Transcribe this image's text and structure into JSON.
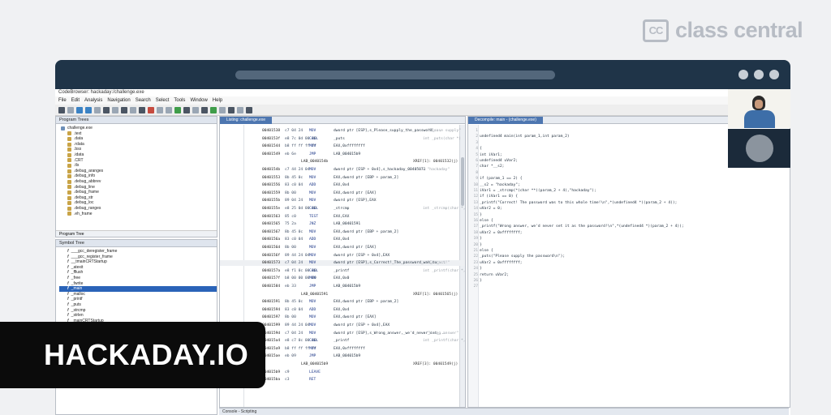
{
  "brand": {
    "badge": "CC",
    "name": "class central"
  },
  "overlay": {
    "label": "HACKADAY.IO"
  },
  "app": {
    "title": "CodeBrowser: hackaday:/challenge.exe",
    "menu": [
      "File",
      "Edit",
      "Analysis",
      "Navigation",
      "Search",
      "Select",
      "Tools",
      "Window",
      "Help"
    ]
  },
  "program_tree": {
    "title": "Program Trees",
    "root": "challenge.exe",
    "sections": [
      ".text",
      ".data",
      ".rdata",
      ".bss",
      ".idata",
      ".CRT",
      ".tls",
      ".debug_aranges",
      ".debug_info",
      ".debug_abbrev",
      ".debug_line",
      ".debug_frame",
      ".debug_str",
      ".debug_loc",
      ".debug_ranges",
      ".eh_frame"
    ],
    "tab": "Program Tree"
  },
  "symbol_tree": {
    "title": "Symbol Tree",
    "functions": [
      "___gcc_deregister_frame",
      "___gcc_register_frame",
      "__tmainCRTStartup",
      "_atexit",
      "_fflush",
      "_free",
      "_fwrite",
      "_main",
      "_malloc",
      "_printf",
      "_puts",
      "_strcmp",
      "_strlen",
      "_mainCRTStartup",
      "_WinMainCRTStartup",
      "_pei386_runtime_relocator",
      "_onexit"
    ],
    "selected": "_main"
  },
  "listing": {
    "tab": "Listing: challenge.exe",
    "rows": [
      {
        "addr": "00401538",
        "bytes": "c7 04 24",
        "mn": "MOV",
        "op": "dword ptr [ESP],s_Please_supply_the_password_...",
        "cm": "= \"Please supply\""
      },
      {
        "addr": "0040153f",
        "bytes": "e8 7c 0d 00 00",
        "mn": "CALL",
        "op": "_puts",
        "cm": "int _puts(char *)"
      },
      {
        "addr": "00401544",
        "bytes": "b8 ff ff ff ff",
        "mn": "MOV",
        "op": "EAX,0xffffffff",
        "cm": ""
      },
      {
        "addr": "00401549",
        "bytes": "eb 6e",
        "mn": "JMP",
        "op": "LAB_004015b9",
        "cm": ""
      },
      {
        "label": "LAB_0040154b",
        "xref": "XREF[1]:  00401532(j)"
      },
      {
        "addr": "0040154b",
        "bytes": "c7 44 24 04",
        "mn": "MOV",
        "op": "dword ptr [ESP + 0x4],s_hackaday_00405071",
        "cm": "= \"hackaday\""
      },
      {
        "addr": "00401553",
        "bytes": "8b 45 0c",
        "mn": "MOV",
        "op": "EAX,dword ptr [EBP + param_2]",
        "cm": ""
      },
      {
        "addr": "00401556",
        "bytes": "83 c0 04",
        "mn": "ADD",
        "op": "EAX,0x4",
        "cm": ""
      },
      {
        "addr": "00401559",
        "bytes": "8b 00",
        "mn": "MOV",
        "op": "EAX,dword ptr [EAX]",
        "cm": ""
      },
      {
        "addr": "0040155b",
        "bytes": "89 04 24",
        "mn": "MOV",
        "op": "dword ptr [ESP],EAX",
        "cm": ""
      },
      {
        "addr": "0040155e",
        "bytes": "e8 25 0d 00 00",
        "mn": "CALL",
        "op": "_strcmp",
        "cm": "int _strcmp(char *, char *)"
      },
      {
        "addr": "00401563",
        "bytes": "85 c0",
        "mn": "TEST",
        "op": "EAX,EAX",
        "cm": ""
      },
      {
        "addr": "00401565",
        "bytes": "75 2a",
        "mn": "JNZ",
        "op": "LAB_00401591",
        "cm": ""
      },
      {
        "addr": "00401567",
        "bytes": "8b 45 0c",
        "mn": "MOV",
        "op": "EAX,dword ptr [EBP + param_2]",
        "cm": ""
      },
      {
        "addr": "0040156a",
        "bytes": "83 c0 04",
        "mn": "ADD",
        "op": "EAX,0x4",
        "cm": ""
      },
      {
        "addr": "0040156d",
        "bytes": "8b 00",
        "mn": "MOV",
        "op": "EAX,dword ptr [EAX]",
        "cm": ""
      },
      {
        "addr": "0040156f",
        "bytes": "89 44 24 04",
        "mn": "MOV",
        "op": "dword ptr [ESP + 0x4],EAX",
        "cm": ""
      },
      {
        "addr": "00401573",
        "bytes": "c7 04 24",
        "mn": "MOV",
        "op": "dword ptr [ESP],s_Correct!_The_password_was_to_...",
        "cm": "= \"Correct!\""
      },
      {
        "addr": "0040157a",
        "bytes": "e8 f1 0c 00 00",
        "mn": "CALL",
        "op": "_printf",
        "cm": "int _printf(char *, ...)"
      },
      {
        "addr": "0040157f",
        "bytes": "b8 00 00 00 00",
        "mn": "MOV",
        "op": "EAX,0x0",
        "cm": ""
      },
      {
        "addr": "00401584",
        "bytes": "eb 33",
        "mn": "JMP",
        "op": "LAB_004015b9",
        "cm": ""
      },
      {
        "label": "LAB_00401591",
        "xref": "XREF[1]:  00401565(j)"
      },
      {
        "addr": "00401591",
        "bytes": "8b 45 0c",
        "mn": "MOV",
        "op": "EAX,dword ptr [EBP + param_2]",
        "cm": ""
      },
      {
        "addr": "00401594",
        "bytes": "83 c0 04",
        "mn": "ADD",
        "op": "EAX,0x4",
        "cm": ""
      },
      {
        "addr": "00401597",
        "bytes": "8b 00",
        "mn": "MOV",
        "op": "EAX,dword ptr [EAX]",
        "cm": ""
      },
      {
        "addr": "00401599",
        "bytes": "89 44 24 04",
        "mn": "MOV",
        "op": "dword ptr [ESP + 0x4],EAX",
        "cm": ""
      },
      {
        "addr": "0040159d",
        "bytes": "c7 04 24",
        "mn": "MOV",
        "op": "dword ptr [ESP],s_Wrong_answer,_we'd_never_set_...",
        "cm": "= \"Wrong answer\""
      },
      {
        "addr": "004015a4",
        "bytes": "e8 c7 0c 00 00",
        "mn": "CALL",
        "op": "_printf",
        "cm": "int _printf(char *, ...)"
      },
      {
        "addr": "004015a9",
        "bytes": "b8 ff ff ff ff",
        "mn": "MOV",
        "op": "EAX,0xffffffff",
        "cm": ""
      },
      {
        "addr": "004015ae",
        "bytes": "eb 09",
        "mn": "JMP",
        "op": "LAB_004015b9",
        "cm": ""
      },
      {
        "label": "LAB_004015b9",
        "xref": "XREF[3]:  00401549(j)"
      },
      {
        "addr": "004015b9",
        "bytes": "c9",
        "mn": "LEAVE",
        "op": "",
        "cm": ""
      },
      {
        "addr": "004015ba",
        "bytes": "c3",
        "mn": "RET",
        "op": "",
        "cm": ""
      }
    ]
  },
  "decompiler": {
    "tab": "Decompile: main - (challenge.exe)",
    "lines": [
      "",
      "undefined4 main(int param_1,int param_2)",
      "",
      "{",
      "  int iVar1;",
      "  undefined4 uVar2;",
      "  char *__s2;",
      "",
      "  if (param_1 == 2) {",
      "    __s2 = \"hackaday\";",
      "    iVar1 = _strcmp(*(char **)(param_2 + 4),\"hackaday\");",
      "    if (iVar1 == 0) {",
      "      _printf(\"Correct! The password was to this whole time!\\n\",*(undefined4 *)(param_2 + 4));",
      "      uVar2 = 0;",
      "    }",
      "    else {",
      "      _printf(\"Wrong answer, we'd never set it as the password!\\n\",*(undefined4 *)(param_2 + 4));",
      "      uVar2 = 0xffffffff;",
      "    }",
      "  }",
      "  else {",
      "    _puts(\"Please supply the password\\n\");",
      "    uVar2 = 0xffffffff;",
      "  }",
      "  return uVar2;",
      "}",
      ""
    ]
  },
  "console": {
    "title": "Console - Scripting"
  }
}
